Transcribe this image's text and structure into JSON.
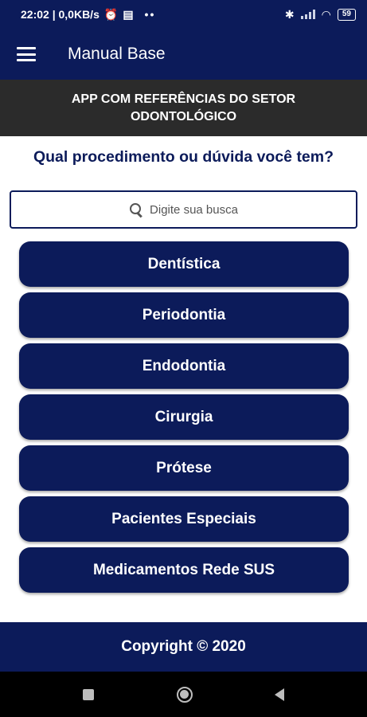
{
  "status_bar": {
    "time_info": "22:02 | 0,0KB/s",
    "dots": "••",
    "battery": "59"
  },
  "app_bar": {
    "title": "Manual Base"
  },
  "banner": {
    "text": "APP COM REFERÊNCIAS DO SETOR ODONTOLÓGICO"
  },
  "question": "Qual procedimento ou dúvida você tem?",
  "search": {
    "placeholder": "Digite sua busca"
  },
  "categories": [
    {
      "label": "Dentística"
    },
    {
      "label": "Periodontia"
    },
    {
      "label": "Endodontia"
    },
    {
      "label": "Cirurgia"
    },
    {
      "label": "Prótese"
    },
    {
      "label": "Pacientes Especiais"
    },
    {
      "label": "Medicamentos Rede SUS"
    }
  ],
  "footer": {
    "copyright": "Copyright © 2020"
  },
  "colors": {
    "primary": "#0c1b5a",
    "banner_bg": "#2b2b2b",
    "nav_bg": "#000000"
  },
  "icons": {
    "menu": "hamburger-menu-icon",
    "search": "search-icon",
    "nav_recents": "square-icon",
    "nav_home": "circle-icon",
    "nav_back": "triangle-back-icon"
  }
}
